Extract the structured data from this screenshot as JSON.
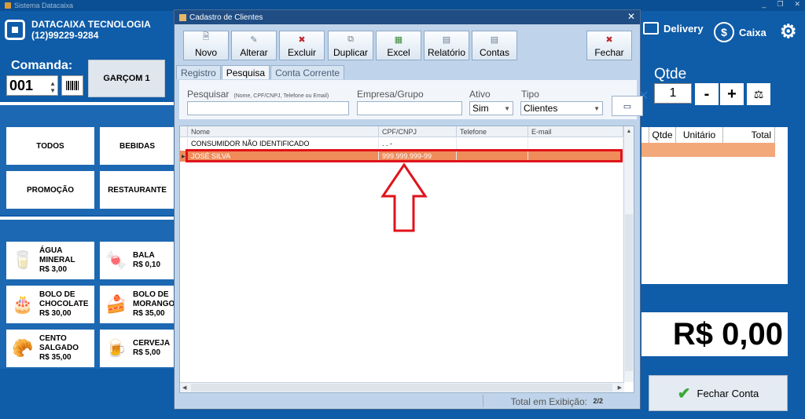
{
  "app": {
    "title": "Sistema Datacaixa",
    "win_controls": [
      "_",
      "❐",
      "✕"
    ]
  },
  "brand": {
    "name": "DATACAIXA TECNOLOGIA",
    "phone": "(12)99229-9284"
  },
  "comanda": {
    "label": "Comanda:",
    "value": "001",
    "garcom_label": "GARÇOM 1"
  },
  "categories": [
    "TODOS",
    "BEBIDAS",
    "PROMOÇÃO",
    "RESTAURANTE"
  ],
  "products": [
    {
      "name_l1": "ÁGUA",
      "name_l2": "MINERAL",
      "price": "R$ 3,00",
      "icon": "water-bottle-icon"
    },
    {
      "name_l1": "BALA",
      "name_l2": "",
      "price": "R$ 0,10",
      "icon": "candy-icon"
    },
    {
      "name_l1": "BOLO DE",
      "name_l2": "CHOCOLATE",
      "price": "R$ 30,00",
      "icon": "chocolate-cake-icon"
    },
    {
      "name_l1": "BOLO DE",
      "name_l2": "MORANGO",
      "price": "R$ 35,00",
      "icon": "strawberry-cake-icon"
    },
    {
      "name_l1": "CENTO",
      "name_l2": "SALGADO",
      "price": "R$ 35,00",
      "icon": "savory-snacks-icon"
    },
    {
      "name_l1": "CERVEJA",
      "name_l2": "",
      "price": "R$ 5,00",
      "icon": "beer-mug-icon"
    }
  ],
  "right": {
    "delivery_label": "Delivery",
    "caixa_label": "Caixa",
    "qtde_label": "Qtde",
    "qtde_value": "1",
    "minus_label": "-",
    "plus_label": "+",
    "order_columns": [
      "Qtde",
      "Unitário",
      "Total"
    ],
    "total_value": "R$ 0,00",
    "fechar_conta_label": "Fechar Conta"
  },
  "modal": {
    "title": "Cadastro de Clientes",
    "toolbar": [
      {
        "label": "Novo",
        "icon": "new-document-icon"
      },
      {
        "label": "Alterar",
        "icon": "edit-icon"
      },
      {
        "label": "Excluir",
        "icon": "delete-icon"
      },
      {
        "label": "Duplicar",
        "icon": "duplicate-icon"
      },
      {
        "label": "Excel",
        "icon": "excel-icon"
      },
      {
        "label": "Relatório",
        "icon": "report-icon"
      },
      {
        "label": "Contas",
        "icon": "accounts-icon"
      }
    ],
    "close_button_label": "Fechar",
    "tabs": [
      "Registro",
      "Pesquisa",
      "Conta Corrente"
    ],
    "active_tab": "Pesquisa",
    "filters": {
      "pesquisar_label": "Pesquisar",
      "pesquisar_hint": "(Nome, CPF/CNPJ, Telefone ou Email)",
      "pesquisar_value": "",
      "empresa_label": "Empresa/Grupo",
      "empresa_value": "",
      "ativo_label": "Ativo",
      "ativo_value": "Sim",
      "tipo_label": "Tipo",
      "tipo_value": "Clientes"
    },
    "grid": {
      "columns": [
        "Nome",
        "CPF/CNPJ",
        "Telefone",
        "E-mail"
      ],
      "rows": [
        {
          "nome": "CONSUMIDOR NÃO IDENTIFICADO",
          "cpf": ". . -",
          "telefone": "",
          "email": ""
        },
        {
          "nome": "JOSÉ SILVA",
          "cpf": "999.999.999-99",
          "telefone": "",
          "email": ""
        }
      ],
      "selected_row": 1
    },
    "status": {
      "label": "Total em Exibição:",
      "value": "2/2"
    }
  },
  "colors": {
    "background": "#0f5ca8",
    "selected_row": "#ef8c5a",
    "annotation_red": "#e0131a"
  }
}
